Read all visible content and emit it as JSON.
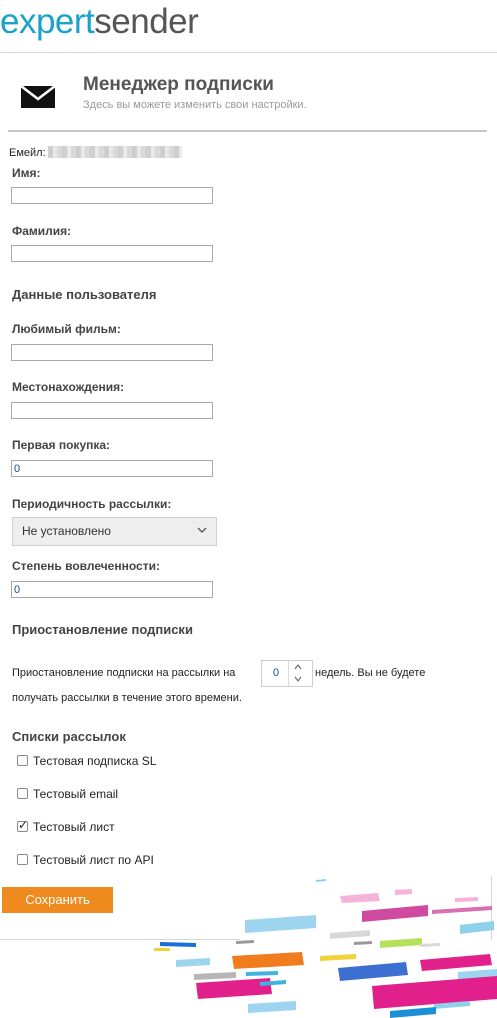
{
  "brand": {
    "logo_part1": "expert",
    "logo_part2": "sender"
  },
  "header": {
    "title": "Менеджер подписки",
    "subtitle": "Здесь вы можете изменить свои настройки."
  },
  "email": {
    "label": "Емейл:"
  },
  "fields": {
    "first_name": {
      "label": "Имя:",
      "value": ""
    },
    "last_name": {
      "label": "Фамилия:",
      "value": ""
    }
  },
  "user_data": {
    "heading": "Данные пользователя",
    "favorite_movie": {
      "label": "Любимый фильм:",
      "value": ""
    },
    "location": {
      "label": "Местонахождения:",
      "value": ""
    },
    "first_purchase": {
      "label": "Первая покупка:",
      "value": "0"
    },
    "frequency": {
      "label": "Периодичность рассылки:",
      "selected": "Не установлено"
    },
    "engagement": {
      "label": "Степень вовлеченности:",
      "value": "0"
    }
  },
  "pause": {
    "heading": "Приостановление подписки",
    "text_before": "Приостановление подписки на рассылки на",
    "weeks_value": "0",
    "text_after": "недель. Вы не будете",
    "text_line2": "получать рассылки в течение этого времени."
  },
  "lists": {
    "heading": "Списки рассылок",
    "items": [
      {
        "label": "Тестовая подписка SL",
        "checked": false
      },
      {
        "label": "Тестовый email",
        "checked": false
      },
      {
        "label": "Тестовый лист",
        "checked": true
      },
      {
        "label": "Тестовый лист по API",
        "checked": false
      }
    ]
  },
  "actions": {
    "save_label": "Сохранить"
  },
  "colors": {
    "brand_blue": "#1aa3c8",
    "brand_gray": "#555555",
    "save_button": "#ee8a1e"
  }
}
